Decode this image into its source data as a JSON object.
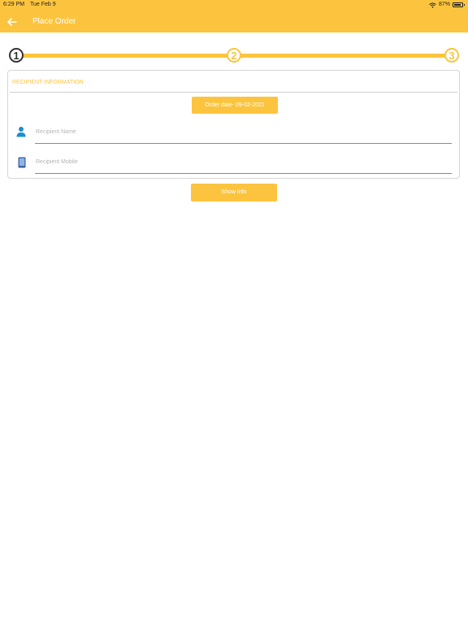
{
  "status_bar": {
    "time": "6:29 PM",
    "date": "Tue Feb 9",
    "battery": "87%",
    "battery_level": 0.87
  },
  "app_bar": {
    "title": "Place Order",
    "back_icon": "arrow-left-icon",
    "color": "#fcc43e"
  },
  "stepper": {
    "steps": [
      "1",
      "2",
      "3"
    ],
    "current": 1
  },
  "recipient": {
    "section_title": "RECIPIENT INFORMATION",
    "order_date_label": "Order date- 09-02-2021",
    "name_placeholder": "Recipient Name",
    "name_icon": "person-icon",
    "mobile_placeholder": "Recipient Mobile",
    "mobile_icon": "mobile-phone-icon"
  },
  "actions": {
    "show_info_label": "Show Info"
  }
}
